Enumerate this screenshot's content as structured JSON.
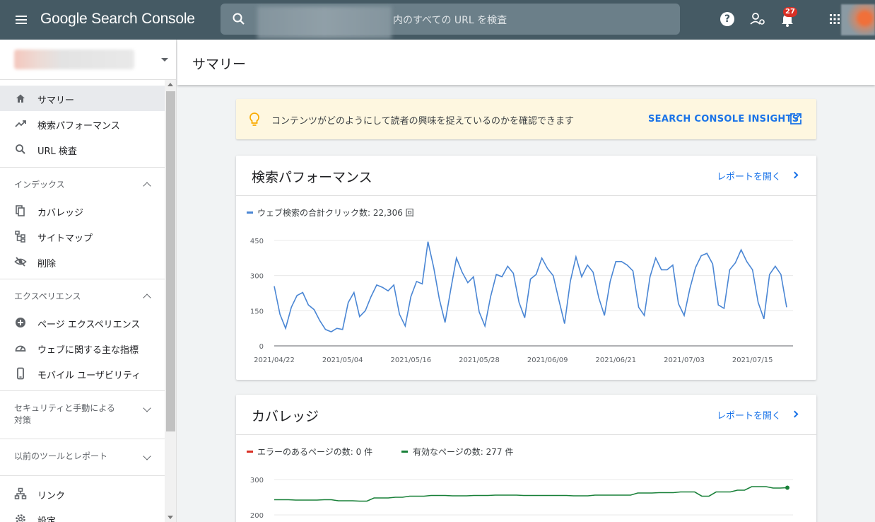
{
  "app": {
    "brand": "Google Search Console",
    "search_placeholder": "内のすべての URL を検査",
    "notification_count": "27"
  },
  "sidebar": {
    "top_items": [
      {
        "label": "サマリー",
        "icon": "home-icon",
        "active": true
      },
      {
        "label": "検索パフォーマンス",
        "icon": "trending-up-icon"
      },
      {
        "label": "URL 検査",
        "icon": "search-icon"
      }
    ],
    "sections": [
      {
        "title": "インデックス",
        "expanded": true,
        "items": [
          {
            "label": "カバレッジ",
            "icon": "copy-icon"
          },
          {
            "label": "サイトマップ",
            "icon": "sitemap-icon"
          },
          {
            "label": "削除",
            "icon": "visibility-off-icon"
          }
        ]
      },
      {
        "title": "エクスペリエンス",
        "expanded": true,
        "items": [
          {
            "label": "ページ エクスペリエンス",
            "icon": "add-circle-icon"
          },
          {
            "label": "ウェブに関する主な指標",
            "icon": "speed-gauge-icon"
          },
          {
            "label": "モバイル ユーザビリティ",
            "icon": "smartphone-icon"
          }
        ]
      },
      {
        "title": "セキュリティと手動による\n対策",
        "expanded": false
      },
      {
        "title": "以前のツールとレポート",
        "expanded": false
      }
    ],
    "bottom_items": [
      {
        "label": "リンク",
        "icon": "links-icon"
      },
      {
        "label": "設定",
        "icon": "settings-icon"
      }
    ]
  },
  "page": {
    "title": "サマリー"
  },
  "insight": {
    "text": "コンテンツがどのようにして読者の興味を捉えているのかを確認できます",
    "link": "SEARCH CONSOLE INSIGHTS",
    "icon": "lightbulb-icon"
  },
  "colors": {
    "clicks": "#4a86d4",
    "errors": "#d93025",
    "valid": "#188038",
    "accent": "#1a73e8",
    "topbar": "#455a64"
  },
  "performance": {
    "title": "検索パフォーマンス",
    "link": "レポートを開く",
    "legend": "ウェブ検索の合計クリック数: 22,306 回"
  },
  "coverage": {
    "title": "カバレッジ",
    "link": "レポートを開く",
    "legend_errors": "エラーのあるページの数: 0 件",
    "legend_valid": "有効なページの数: 277 件"
  },
  "chart_data": [
    {
      "type": "line",
      "series": [
        {
          "name": "ウェブ検索の合計クリック数: 22,306 回",
          "values": [
            255,
            135,
            75,
            165,
            215,
            228,
            175,
            155,
            108,
            70,
            60,
            75,
            70,
            185,
            228,
            125,
            150,
            210,
            260,
            250,
            235,
            260,
            135,
            85,
            210,
            275,
            265,
            445,
            335,
            200,
            100,
            240,
            375,
            315,
            270,
            295,
            145,
            85,
            210,
            305,
            295,
            340,
            310,
            185,
            120,
            285,
            305,
            375,
            330,
            300,
            195,
            95,
            275,
            380,
            295,
            345,
            315,
            205,
            130,
            275,
            360,
            360,
            345,
            320,
            165,
            130,
            295,
            375,
            325,
            325,
            345,
            180,
            130,
            245,
            335,
            385,
            395,
            350,
            175,
            160,
            325,
            355,
            410,
            360,
            325,
            185,
            115,
            305,
            340,
            305,
            165
          ]
        }
      ],
      "x_tick_labels": [
        "2021/04/22",
        "2021/05/04",
        "2021/05/16",
        "2021/05/28",
        "2021/06/09",
        "2021/06/21",
        "2021/07/03",
        "2021/07/15"
      ],
      "y_ticks": [
        "0",
        "150",
        "300",
        "450"
      ],
      "ylim": [
        0,
        450
      ]
    },
    {
      "type": "line",
      "series": [
        {
          "name": "エラーのあるページの数: 0 件",
          "values": [
            0,
            0
          ]
        },
        {
          "name": "有効なページの数: 277 件",
          "values": [
            243,
            243,
            243,
            242,
            242,
            242,
            242,
            243,
            243,
            240,
            240,
            240,
            239,
            239,
            248,
            248,
            248,
            250,
            250,
            253,
            253,
            253,
            255,
            255,
            255,
            254,
            254,
            254,
            255,
            255,
            255,
            256,
            256,
            256,
            256,
            255,
            255,
            255,
            255,
            255,
            255,
            255,
            254,
            254,
            254,
            256,
            256,
            256,
            256,
            256,
            256,
            262,
            262,
            262,
            263,
            263,
            263,
            265,
            265,
            265,
            253,
            253,
            265,
            265,
            265,
            270,
            270,
            280,
            280,
            280,
            276,
            276,
            277
          ]
        }
      ],
      "y_ticks": [
        "200",
        "300"
      ]
    }
  ]
}
